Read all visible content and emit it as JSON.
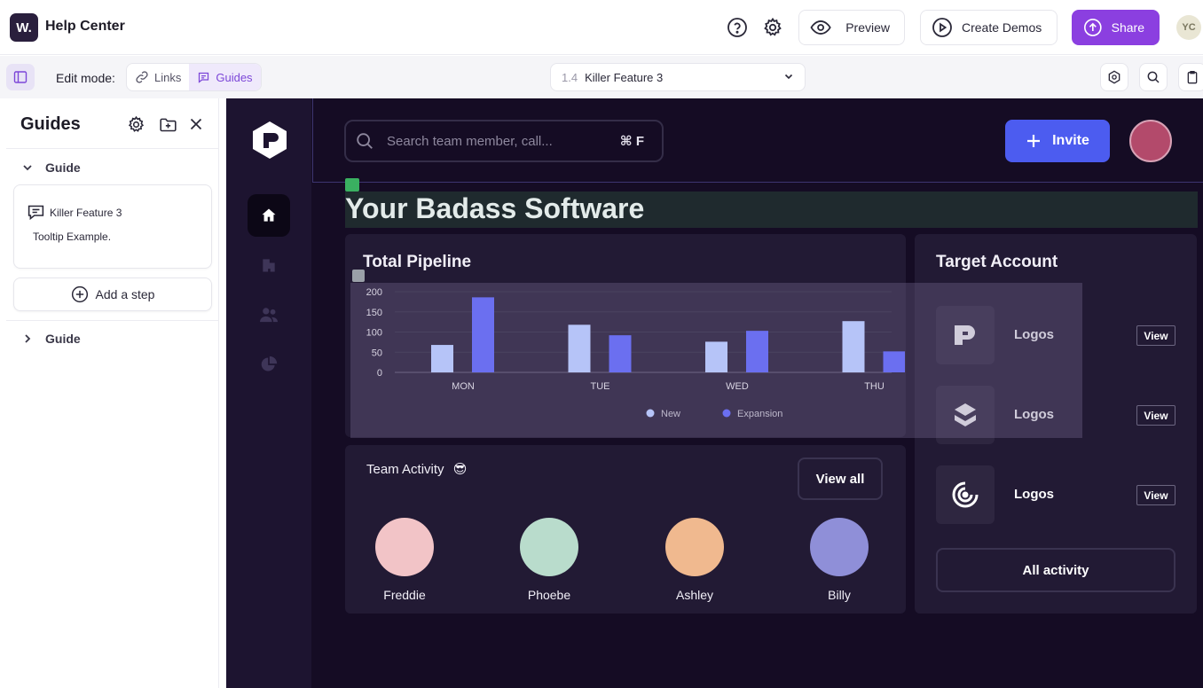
{
  "app": {
    "logo_text": "W.",
    "title": "Help Center"
  },
  "toolbar": {
    "preview_label": "Preview",
    "create_demos_label": "Create Demos",
    "share_label": "Share",
    "user_initials": "YC"
  },
  "editbar": {
    "edit_mode_label": "Edit mode:",
    "modes": [
      {
        "label": "Links"
      },
      {
        "label": "Guides",
        "active": true
      }
    ],
    "step_number": "1.4",
    "step_name": "Killer Feature 3"
  },
  "guides_panel": {
    "title": "Guides",
    "groups": [
      {
        "label": "Guide",
        "expanded": true
      },
      {
        "label": "Guide",
        "expanded": false
      }
    ],
    "step": {
      "title": "Killer Feature 3",
      "description": "Tooltip Example."
    },
    "add_step_label": "Add a step"
  },
  "demo": {
    "search_placeholder": "Search team member, call...",
    "search_shortcut": "⌘ F",
    "invite_label": "Invite",
    "page_title": "Your Badass Software",
    "pipeline": {
      "title": "Total Pipeline"
    },
    "team_activity": {
      "title": "Team Activity",
      "emoji": "😎",
      "view_all_label": "View all",
      "members": [
        {
          "name": "Freddie",
          "color": "#f2c4c7"
        },
        {
          "name": "Phoebe",
          "color": "#b9dccc"
        },
        {
          "name": "Ashley",
          "color": "#f0b98f"
        },
        {
          "name": "Billy",
          "color": "#8f8fd8"
        }
      ]
    },
    "target_account": {
      "title": "Target Account",
      "accounts": [
        {
          "name": "Logos",
          "view_label": "View",
          "icon": "p-logo-icon"
        },
        {
          "name": "Logos",
          "view_label": "View",
          "icon": "layers-logo-icon"
        },
        {
          "name": "Logos",
          "view_label": "View",
          "icon": "signal-logo-icon"
        }
      ],
      "all_activity_label": "All activity"
    }
  },
  "chart_data": {
    "type": "bar",
    "title": "Total Pipeline",
    "categories": [
      "MON",
      "TUE",
      "WED",
      "THU"
    ],
    "series": [
      {
        "name": "New",
        "color": "#b6c4f8",
        "values": [
          68,
          118,
          76,
          127
        ]
      },
      {
        "name": "Expansion",
        "color": "#6b6ff0",
        "values": [
          186,
          92,
          103,
          52
        ]
      }
    ],
    "yticks": [
      0,
      50,
      100,
      150,
      200
    ],
    "ylim": [
      0,
      200
    ],
    "grid": true,
    "legend_position": "bottom-center"
  }
}
